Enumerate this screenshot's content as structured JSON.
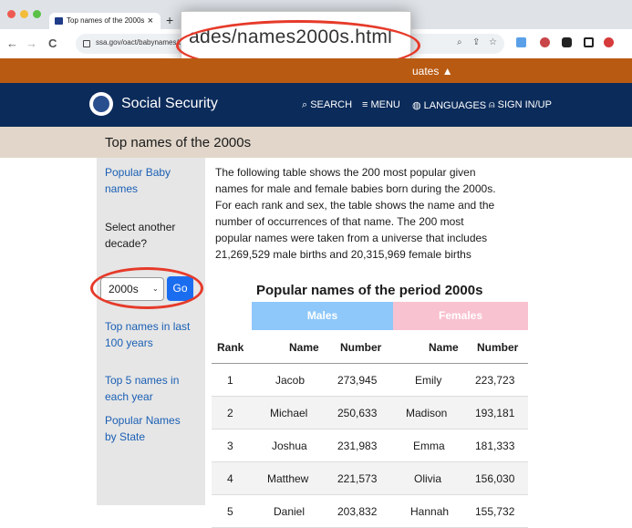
{
  "browser": {
    "tab_title": "Top names of the 2000s",
    "tab_close": "×",
    "new_tab": "+",
    "back": "←",
    "forward": "→",
    "reload": "C",
    "url": "ssa.gov/oact/babynames/de",
    "zoomed_url": "ades/names2000s.html",
    "traffic_lights": [
      "#ee5b52",
      "#f3bc3b",
      "#5ac146"
    ]
  },
  "banner": {
    "text": "uates ▲",
    "color": "#b85a12"
  },
  "nav": {
    "brand": "Social Security",
    "items": [
      "⌕ SEARCH",
      "≡ MENU",
      "◍ LANGUAGES",
      "⍝ SIGN IN/UP"
    ],
    "color": "#0b2b5a"
  },
  "page_title": "Top names of the 2000s",
  "sidebar": {
    "popular_baby_names": [
      "Popular Baby",
      "names"
    ],
    "select_label": [
      "Select another",
      "decade?"
    ],
    "select_value": "2000s",
    "go_label": "Go",
    "top_names_100": [
      "Top names in last",
      "100 years"
    ],
    "top5": [
      "Top 5 names in",
      "each year"
    ],
    "by_state": [
      "Popular Names",
      "by State"
    ]
  },
  "intro_lines": [
    "The following table shows the 200 most popular given",
    "names for male and female babies born during the 2000s.",
    "For each rank and sex, the table shows the name and the",
    "number of occurrences of that name. The 200 most",
    "popular names were taken from a universe that includes",
    "21,269,529 male births and 20,315,969 female births"
  ],
  "table": {
    "caption": "Popular names of the period 2000s",
    "groups": {
      "males": "Males",
      "females": "Females",
      "male_color": "#8ec8fb",
      "female_color": "#f9c2d0"
    },
    "headers": [
      "Rank",
      "Name",
      "Number",
      "Name",
      "Number"
    ],
    "rows": [
      [
        "1",
        "Jacob",
        "273,945",
        "Emily",
        "223,723"
      ],
      [
        "2",
        "Michael",
        "250,633",
        "Madison",
        "193,181"
      ],
      [
        "3",
        "Joshua",
        "231,983",
        "Emma",
        "181,333"
      ],
      [
        "4",
        "Matthew",
        "221,573",
        "Olivia",
        "156,030"
      ],
      [
        "5",
        "Daniel",
        "203,832",
        "Hannah",
        "155,732"
      ]
    ]
  },
  "annotation_color": "#e63a2a"
}
